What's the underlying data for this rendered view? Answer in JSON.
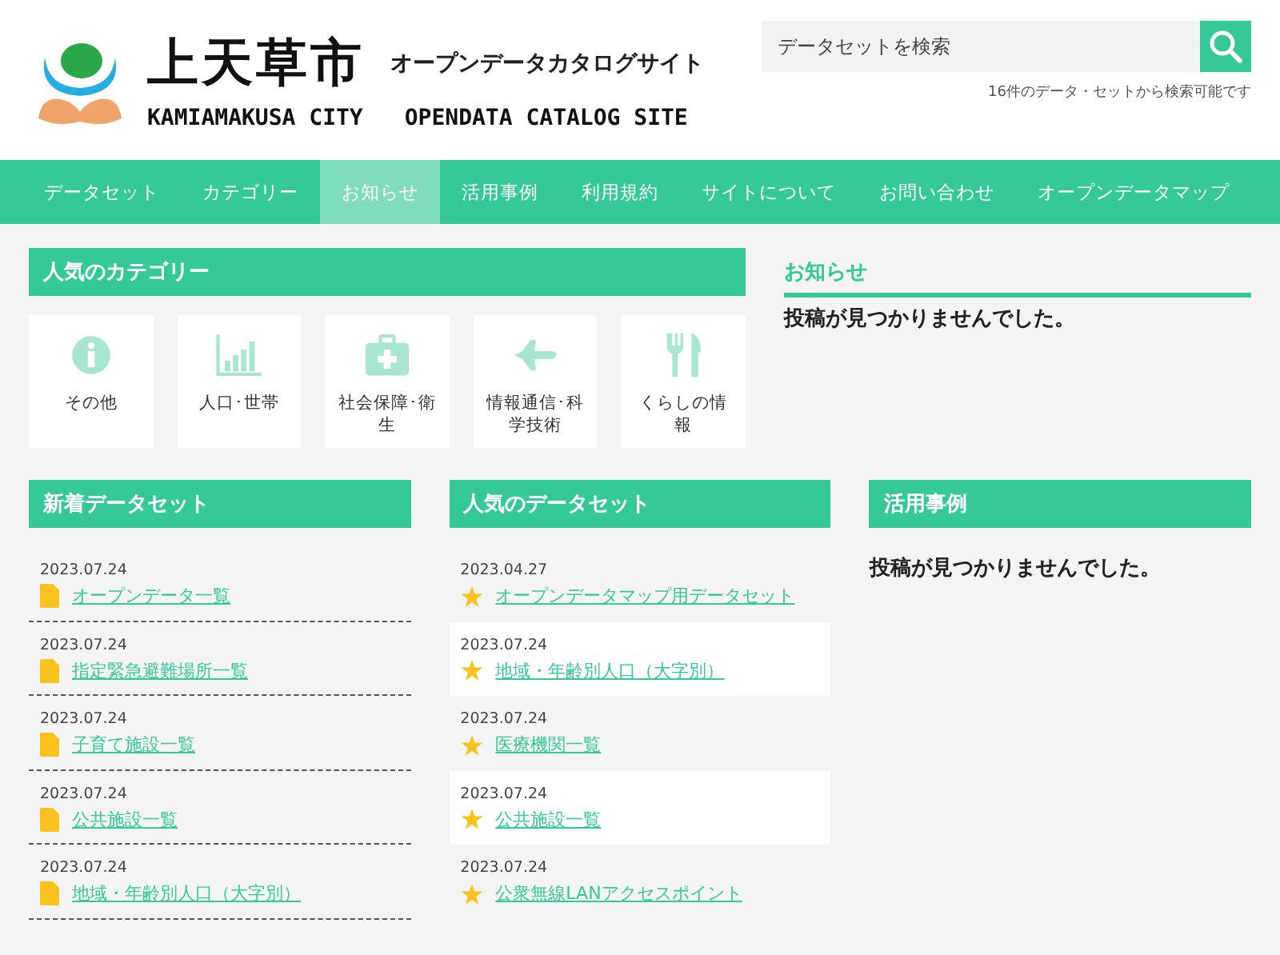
{
  "header": {
    "title": "上天草市",
    "subtitle": "オープンデータカタログサイト",
    "title_en": "KAMIAMAKUSA CITY",
    "subtitle_en": "OPENDATA CATALOG SITE",
    "search": {
      "placeholder": "データセットを検索"
    },
    "search_note": "16件のデータ・セットから検索可能です"
  },
  "nav": [
    {
      "label": "データセット",
      "selected": false
    },
    {
      "label": "カテゴリー",
      "selected": false
    },
    {
      "label": "お知らせ",
      "selected": true
    },
    {
      "label": "活用事例",
      "selected": false
    },
    {
      "label": "利用規約",
      "selected": false
    },
    {
      "label": "サイトについて",
      "selected": false
    },
    {
      "label": "お問い合わせ",
      "selected": false
    },
    {
      "label": "オープンデータマップ",
      "selected": false
    }
  ],
  "popular_categories": {
    "title": "人気のカテゴリー",
    "items": [
      {
        "kind": "info",
        "label": "その他"
      },
      {
        "kind": "chart",
        "label": "人口･世帯"
      },
      {
        "kind": "medical",
        "label": "社会保障･衛生"
      },
      {
        "kind": "plane",
        "label": "情報通信･科学技術"
      },
      {
        "kind": "food",
        "label": "くらしの情報"
      }
    ]
  },
  "news": {
    "title": "お知らせ",
    "message": "投稿が見つかりませんでした。"
  },
  "new_datasets": {
    "title": "新着データセット",
    "items": [
      {
        "date": "2023.07.24",
        "name": "オープンデータ一覧"
      },
      {
        "date": "2023.07.24",
        "name": "指定緊急避難場所一覧"
      },
      {
        "date": "2023.07.24",
        "name": "子育て施設一覧"
      },
      {
        "date": "2023.07.24",
        "name": "公共施設一覧"
      },
      {
        "date": "2023.07.24",
        "name": "地域・年齢別人口（大字別）"
      }
    ]
  },
  "popular_datasets": {
    "title": "人気のデータセット",
    "items": [
      {
        "date": "2023.04.27",
        "name": "オープンデータマップ用データセット"
      },
      {
        "date": "2023.07.24",
        "name": "地域・年齢別人口（大字別）"
      },
      {
        "date": "2023.07.24",
        "name": "医療機関一覧"
      },
      {
        "date": "2023.07.24",
        "name": "公共施設一覧"
      },
      {
        "date": "2023.07.24",
        "name": "公衆無線LANアクセスポイント"
      }
    ]
  },
  "use_cases": {
    "title": "活用事例",
    "message": "投稿が見つかりませんでした。"
  }
}
